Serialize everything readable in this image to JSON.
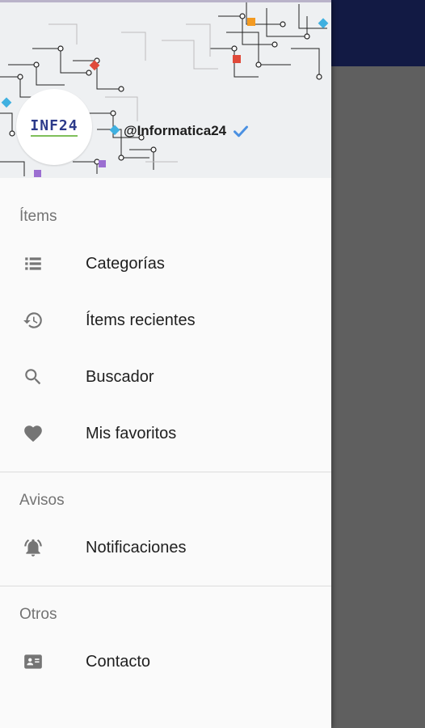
{
  "header": {
    "avatar_text": "INF24",
    "handle": "@Informatica24"
  },
  "sections": [
    {
      "title": "Ítems",
      "items": [
        {
          "label": "Categorías",
          "icon": "list-icon"
        },
        {
          "label": "Ítems recientes",
          "icon": "history-icon"
        },
        {
          "label": "Buscador",
          "icon": "search-icon"
        },
        {
          "label": "Mis favoritos",
          "icon": "heart-icon"
        }
      ]
    },
    {
      "title": "Avisos",
      "items": [
        {
          "label": "Notificaciones",
          "icon": "bell-icon"
        }
      ]
    },
    {
      "title": "Otros",
      "items": [
        {
          "label": "Contacto",
          "icon": "contact-card-icon"
        }
      ]
    }
  ],
  "colors": {
    "toolbar": "#121a44",
    "scrim": "#5f5f5f",
    "drawer_bg": "#fafafa",
    "verified": "#4a90e2"
  }
}
